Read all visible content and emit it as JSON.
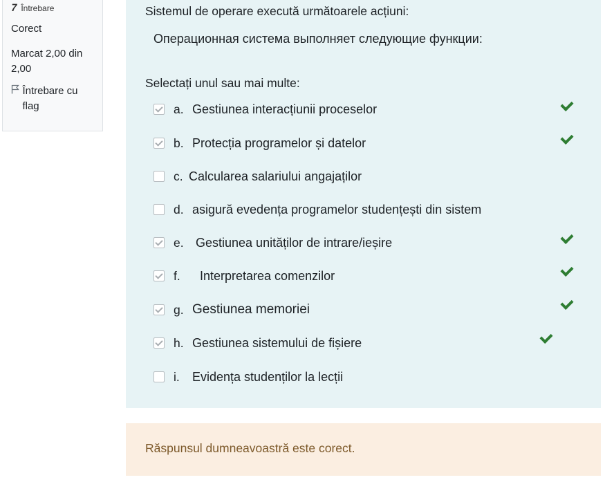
{
  "info": {
    "question_label": "Întrebare",
    "question_glyph": "7",
    "state": "Corect",
    "grade": "Marcat 2,00 din 2,00",
    "flag_label": "Întrebare cu flag",
    "flag_icon": "flag-outline-icon"
  },
  "question": {
    "text_ro": "Sistemul de operare execută următoarele acțiuni:",
    "text_ru": "Операционная система выполняет следующие функции:",
    "prompt": "Selectați unul sau mai multe:",
    "options": [
      {
        "letter": "a.",
        "text": "Gestiunea interacțiunii proceselor",
        "checked": true,
        "correct_mark": true
      },
      {
        "letter": "b.",
        "text": "Protecția programelor și datelor",
        "checked": true,
        "correct_mark": true
      },
      {
        "letter": "c.",
        "text": "Calcularea salariului angajaților",
        "checked": false,
        "correct_mark": false
      },
      {
        "letter": "d.",
        "text": "asigură evedența programelor studențești din sistem",
        "checked": false,
        "correct_mark": false
      },
      {
        "letter": "e.",
        "text": "Gestiunea unităților de intrare/ieșire",
        "checked": true,
        "correct_mark": true
      },
      {
        "letter": "f.",
        "text": "Interpretarea comenzilor",
        "checked": true,
        "correct_mark": true
      },
      {
        "letter": "g.",
        "text": "Gestiunea memoriei",
        "checked": true,
        "correct_mark": true
      },
      {
        "letter": "h.",
        "text": "Gestiunea sistemului de fișiere",
        "checked": true,
        "correct_mark": true
      },
      {
        "letter": "i.",
        "text": "Evidența studenților la lecții",
        "checked": false,
        "correct_mark": false
      }
    ]
  },
  "feedback": {
    "text": "Răspunsul dumneavoastră este corect."
  },
  "colors": {
    "question_bg": "#e7f3f5",
    "feedback_bg": "#fbeee1",
    "feedback_text": "#7d5a2b",
    "tick": "#2e7d32"
  }
}
